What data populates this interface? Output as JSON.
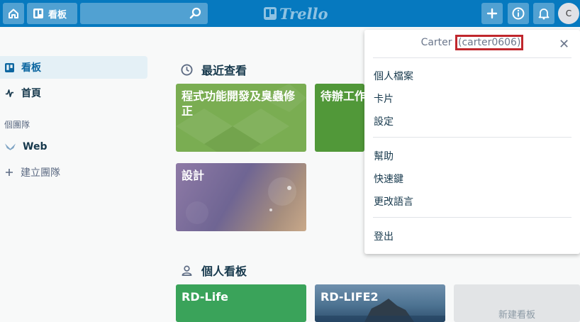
{
  "topbar": {
    "boards_label": "看板",
    "search_placeholder": "",
    "logo_text": "Trello",
    "avatar_initial": "C",
    "icons": [
      "home-icon",
      "boards-icon",
      "search-icon",
      "plus-icon",
      "info-icon",
      "bell-icon"
    ]
  },
  "sidebar": {
    "boards_label": "看板",
    "home_label": "首頁",
    "teams_heading": "個團隊",
    "team_label": "Web",
    "create_team_label": "建立團隊"
  },
  "recent": {
    "title": "最近查看",
    "boards": [
      {
        "name": "程式功能開發及臭蟲修正",
        "color": "#7aad52"
      },
      {
        "name": "待辦工作",
        "color": "#519839"
      },
      {
        "name": "設計",
        "color": "#7a6e93"
      }
    ]
  },
  "personal": {
    "title": "個人看板",
    "boards": [
      {
        "name": "RD-Life",
        "color": "#3aa35a"
      },
      {
        "name": "RD-LIFE2",
        "color": "#5b7d98"
      }
    ],
    "new_board_label": "新建看板"
  },
  "account_menu": {
    "display_name": "Carter",
    "username": "(carter0606)",
    "close_glyph": "✕",
    "items_group1": [
      "個人檔案",
      "卡片",
      "設定"
    ],
    "items_group2": [
      "幫助",
      "快速鍵",
      "更改語言"
    ],
    "items_group3": [
      "登出"
    ],
    "highlight_color": "#c0272d"
  }
}
